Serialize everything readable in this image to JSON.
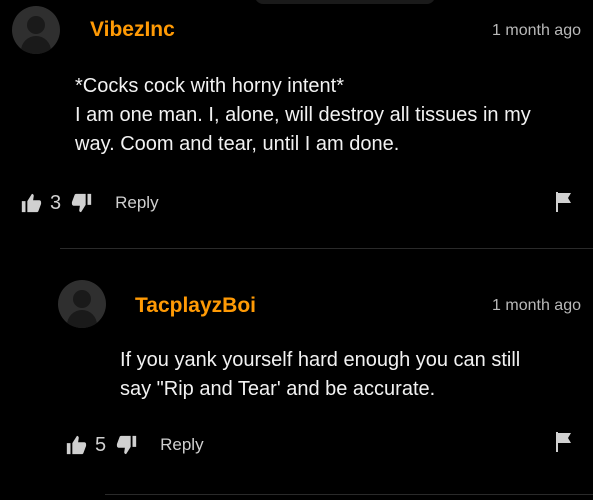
{
  "comments": [
    {
      "username": "VibezInc",
      "timestamp": "1 month ago",
      "lines": [
        "*Cocks cock with horny intent*",
        "I am one man. I, alone, will destroy all tissues in my",
        "way. Coom and tear, until I am done."
      ],
      "likes": "3",
      "reply_label": "Reply"
    },
    {
      "username": "TacplayzBoi",
      "timestamp": "1 month ago",
      "lines": [
        "If you yank yourself hard enough you can still",
        "say \"Rip and Tear' and be accurate."
      ],
      "likes": "5",
      "reply_label": "Reply"
    }
  ],
  "icons": {
    "like": "thumbs-up-icon",
    "dislike": "thumbs-down-icon",
    "flag": "flag-icon",
    "avatar": "default-avatar"
  },
  "colors": {
    "background": "#000000",
    "username": "#ff9a05",
    "text": "#f2f2f2",
    "muted": "#b9b9b9"
  }
}
